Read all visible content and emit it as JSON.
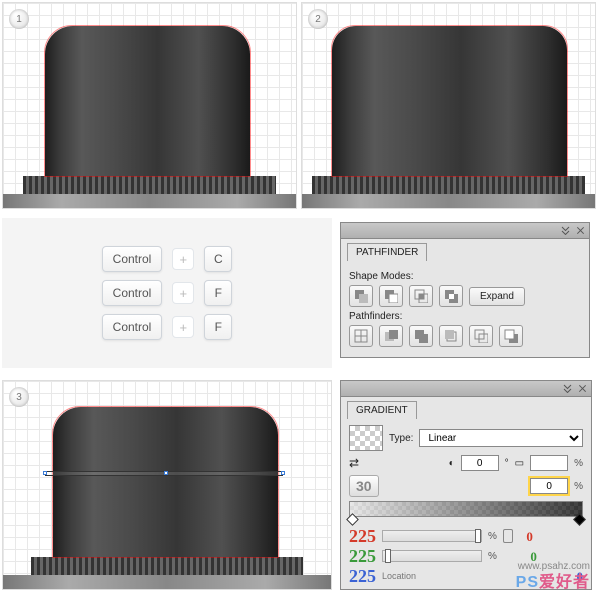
{
  "steps": {
    "s1": "1",
    "s2": "2",
    "s3": "3"
  },
  "shortcuts": {
    "ctrl": "Control",
    "keys": [
      "C",
      "F",
      "F"
    ]
  },
  "pathfinder": {
    "title": "PATHFINDER",
    "shape_modes_label": "Shape Modes:",
    "expand_label": "Expand",
    "pathfinders_label": "Pathfinders:"
  },
  "gradient": {
    "title": "GRADIENT",
    "type_label": "Type:",
    "type_value": "Linear",
    "angle": "0",
    "ratio": "",
    "opacity_hint": "30",
    "highlighted_opacity": "0",
    "pct": "%",
    "rgb_left": {
      "r": "225",
      "g": "225",
      "b": "225"
    },
    "rgb_right": {
      "r": "0",
      "g": "0",
      "b": "0"
    },
    "location_label": "Location"
  },
  "watermark": {
    "url": "www.psahz.com",
    "brand_a": "PS",
    "brand_b": "爱好者"
  }
}
